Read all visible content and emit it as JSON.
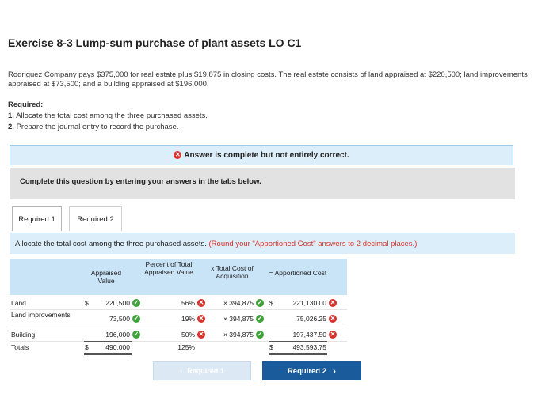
{
  "exercise": {
    "title": "Exercise 8-3 Lump-sum purchase of plant assets LO C1",
    "problem_text": "Rodriguez Company pays $375,000 for real estate plus $19,875 in closing costs. The real estate consists of land appraised at $220,500; land improvements appraised at $73,500; and a building appraised at $196,000.",
    "required_label": "Required:",
    "requirements": [
      {
        "num": "1.",
        "text": "Allocate the total cost among the three purchased assets."
      },
      {
        "num": "2.",
        "text": "Prepare the journal entry to record the purchase."
      }
    ]
  },
  "status_banner": "Answer is complete but not entirely correct.",
  "instruction_box": "Complete this question by entering your answers in the tabs below.",
  "tabs": [
    {
      "label": "Required 1"
    },
    {
      "label": "Required 2"
    }
  ],
  "tab_instruction": {
    "main": "Allocate the total cost among the three purchased assets.",
    "note": "(Round your \"Apportioned Cost\" answers to 2 decimal places.)"
  },
  "table": {
    "headers": {
      "appraised": "Appraised Value",
      "percent": "Percent of Total Appraised Value",
      "cost": "x Total Cost of Acquisition",
      "apportioned": "= Apportioned Cost"
    },
    "rows": [
      {
        "label": "Land",
        "dollar": "$",
        "appraised": "220,500",
        "appraised_ok": true,
        "percent": "56%",
        "percent_ok": false,
        "cost": "× 394,875",
        "cost_ok": true,
        "apportioned_dollar": "$",
        "apportioned": "221,130.00",
        "apportioned_ok": false
      },
      {
        "label": "Land improvements",
        "dollar": "",
        "appraised": "73,500",
        "appraised_ok": true,
        "percent": "19%",
        "percent_ok": false,
        "cost": "× 394,875",
        "cost_ok": true,
        "apportioned_dollar": "",
        "apportioned": "75,026.25",
        "apportioned_ok": false
      },
      {
        "label": "Building",
        "dollar": "",
        "appraised": "196,000",
        "appraised_ok": true,
        "percent": "50%",
        "percent_ok": false,
        "cost": "× 394,875",
        "cost_ok": true,
        "apportioned_dollar": "",
        "apportioned": "197,437.50",
        "apportioned_ok": false
      }
    ],
    "totals": {
      "label": "Totals",
      "dollar": "$",
      "appraised": "490,000",
      "percent": "125%",
      "apportioned_dollar": "$",
      "apportioned": "493,593.75"
    }
  },
  "nav": {
    "prev_label": "Required 1",
    "next_label": "Required 2"
  },
  "colors": {
    "correct": "#3fa33a",
    "incorrect": "#d9312b",
    "primary_button": "#1a5b9c",
    "header_blue": "#c9e3f7"
  }
}
